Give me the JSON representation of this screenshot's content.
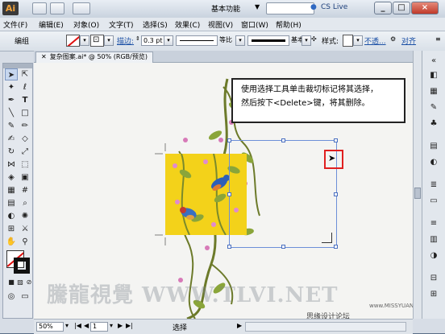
{
  "app": {
    "logo": "Ai",
    "workspace": "基本功能",
    "cs_live": "CS Live"
  },
  "menu": [
    "文件(F)",
    "编辑(E)",
    "对象(O)",
    "文字(T)",
    "选择(S)",
    "效果(C)",
    "视图(V)",
    "窗口(W)",
    "帮助(H)"
  ],
  "control": {
    "group_label": "编组",
    "stroke_label": "描边:",
    "stroke_value": "0.3 pt",
    "profile_label": "等比",
    "brush_label": "基本",
    "style_label": "样式:",
    "opacity_label": "不透...",
    "align_label": "对齐"
  },
  "document": {
    "tab_title": "复杂图案.ai* @ 50% (RGB/预览)"
  },
  "callout": {
    "line1": "使用选择工具单击裁切标记将其选择，",
    "line2": "然后按下<Delete>键，将其删除。"
  },
  "watermark": "騰龍視覺 WWW.TLVI.NET",
  "credit": {
    "forum": "思缘设计论坛",
    "url": "www.MISSYUAN.COM"
  },
  "status": {
    "zoom": "50%",
    "page": "1",
    "tool": "选择"
  },
  "colors": {
    "selection": "#6c8fd8",
    "highlight": "#e02020",
    "artwork_bg": "#f3d21a"
  }
}
